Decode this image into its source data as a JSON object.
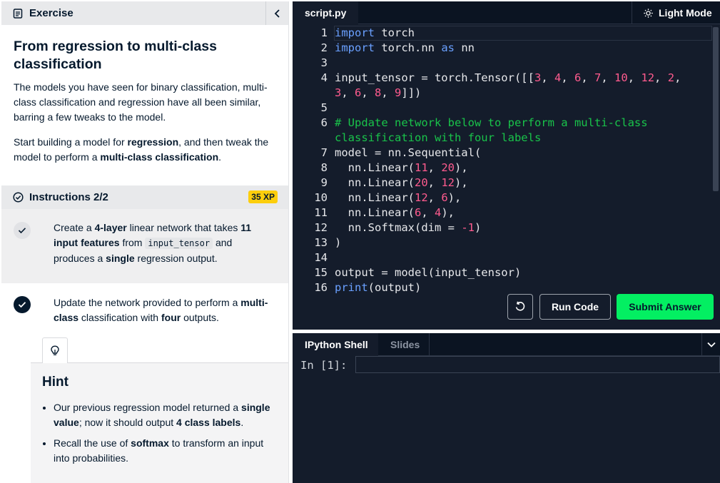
{
  "exercise": {
    "header_title": "Exercise",
    "title": "From regression to multi-class classification",
    "para1": "The models you have seen for binary classification, multi-class classification and regression have all been similar, barring a few tweaks to the model.",
    "para2_pre": "Start building a model for ",
    "para2_b1": "regression",
    "para2_mid": ", and then tweak the model to perform a ",
    "para2_b2": "multi-class classification",
    "para2_post": "."
  },
  "instructions": {
    "title": "Instructions 2/2",
    "xp": "35 XP",
    "step1": {
      "t1": "Create a ",
      "b1": "4-layer",
      "t2": " linear network that takes ",
      "b2": "11 input features",
      "t3": " from ",
      "code": "input_tensor",
      "t4": " and produces a ",
      "b3": "single",
      "t5": " regression output."
    },
    "step2": {
      "t1": "Update the network provided to perform a ",
      "b1": "multi-class",
      "t2": " classification with ",
      "b2": "four",
      "t3": " outputs."
    }
  },
  "hint": {
    "title": "Hint",
    "item1": {
      "t1": "Our previous regression model returned a ",
      "b1": "single value",
      "t2": "; now it should output ",
      "b2": "4 class labels",
      "t3": "."
    },
    "item2": {
      "t1": "Recall the use of ",
      "b1": "softmax",
      "t2": " to transform an input into probabilities."
    }
  },
  "editor": {
    "tab": "script.py",
    "light_mode": "Light Mode",
    "run_label": "Run Code",
    "submit_label": "Submit Answer",
    "lines": [
      {
        "n": "1",
        "code": [
          [
            "kw",
            "import"
          ],
          [
            "t",
            " torch"
          ]
        ]
      },
      {
        "n": "2",
        "code": [
          [
            "kw",
            "import"
          ],
          [
            "t",
            " torch.nn "
          ],
          [
            "kw",
            "as"
          ],
          [
            "t",
            " nn"
          ]
        ]
      },
      {
        "n": "3",
        "code": []
      },
      {
        "n": "4",
        "code": [
          [
            "t",
            "input_tensor = torch.Tensor([["
          ],
          [
            "num",
            "3"
          ],
          [
            "t",
            ", "
          ],
          [
            "num",
            "4"
          ],
          [
            "t",
            ", "
          ],
          [
            "num",
            "6"
          ],
          [
            "t",
            ", "
          ],
          [
            "num",
            "7"
          ],
          [
            "t",
            ", "
          ],
          [
            "num",
            "10"
          ],
          [
            "t",
            ", "
          ],
          [
            "num",
            "12"
          ],
          [
            "t",
            ", "
          ],
          [
            "num",
            "2"
          ],
          [
            "t",
            ","
          ]
        ]
      },
      {
        "n": "",
        "code": [
          [
            "num",
            "3"
          ],
          [
            "t",
            ", "
          ],
          [
            "num",
            "6"
          ],
          [
            "t",
            ", "
          ],
          [
            "num",
            "8"
          ],
          [
            "t",
            ", "
          ],
          [
            "num",
            "9"
          ],
          [
            "t",
            "]])"
          ]
        ]
      },
      {
        "n": "5",
        "code": []
      },
      {
        "n": "6",
        "code": [
          [
            "cm",
            "# Update network below to perform a multi-class"
          ]
        ]
      },
      {
        "n": "",
        "code": [
          [
            "cm",
            "classification with four labels"
          ]
        ]
      },
      {
        "n": "7",
        "code": [
          [
            "t",
            "model = nn.Sequential("
          ]
        ]
      },
      {
        "n": "8",
        "code": [
          [
            "t",
            "  nn.Linear("
          ],
          [
            "num",
            "11"
          ],
          [
            "t",
            ", "
          ],
          [
            "num",
            "20"
          ],
          [
            "t",
            "),"
          ]
        ]
      },
      {
        "n": "9",
        "code": [
          [
            "t",
            "  nn.Linear("
          ],
          [
            "num",
            "20"
          ],
          [
            "t",
            ", "
          ],
          [
            "num",
            "12"
          ],
          [
            "t",
            "),"
          ]
        ]
      },
      {
        "n": "10",
        "code": [
          [
            "t",
            "  nn.Linear("
          ],
          [
            "num",
            "12"
          ],
          [
            "t",
            ", "
          ],
          [
            "num",
            "6"
          ],
          [
            "t",
            "),"
          ]
        ]
      },
      {
        "n": "11",
        "code": [
          [
            "t",
            "  nn.Linear("
          ],
          [
            "num",
            "6"
          ],
          [
            "t",
            ", "
          ],
          [
            "num",
            "4"
          ],
          [
            "t",
            "),"
          ]
        ]
      },
      {
        "n": "12",
        "code": [
          [
            "t",
            "  nn.Softmax(dim = "
          ],
          [
            "num",
            "-1"
          ],
          [
            "t",
            ")"
          ]
        ]
      },
      {
        "n": "13",
        "code": [
          [
            "t",
            ")"
          ]
        ]
      },
      {
        "n": "14",
        "code": []
      },
      {
        "n": "15",
        "code": [
          [
            "t",
            "output = model(input_tensor)"
          ]
        ]
      },
      {
        "n": "16",
        "code": [
          [
            "kw",
            "print"
          ],
          [
            "t",
            "(output)"
          ]
        ]
      }
    ]
  },
  "shell": {
    "tab_ipython": "IPython Shell",
    "tab_slides": "Slides",
    "prompt": "In [1]:"
  },
  "colors": {
    "accent_green": "#03ef62",
    "xp_yellow": "#fcce0d",
    "editor_bg": "#141c2b",
    "keyword": "#6aa0ff",
    "number": "#ff5b8e",
    "comment": "#19c34a"
  },
  "icons": {
    "header": "document-icon",
    "collapse": "chevron-left-icon",
    "instructions": "check-circle-icon",
    "hint": "lightbulb-icon",
    "theme": "sun-icon",
    "reset": "reset-icon",
    "shell_menu": "chevron-down-icon"
  }
}
